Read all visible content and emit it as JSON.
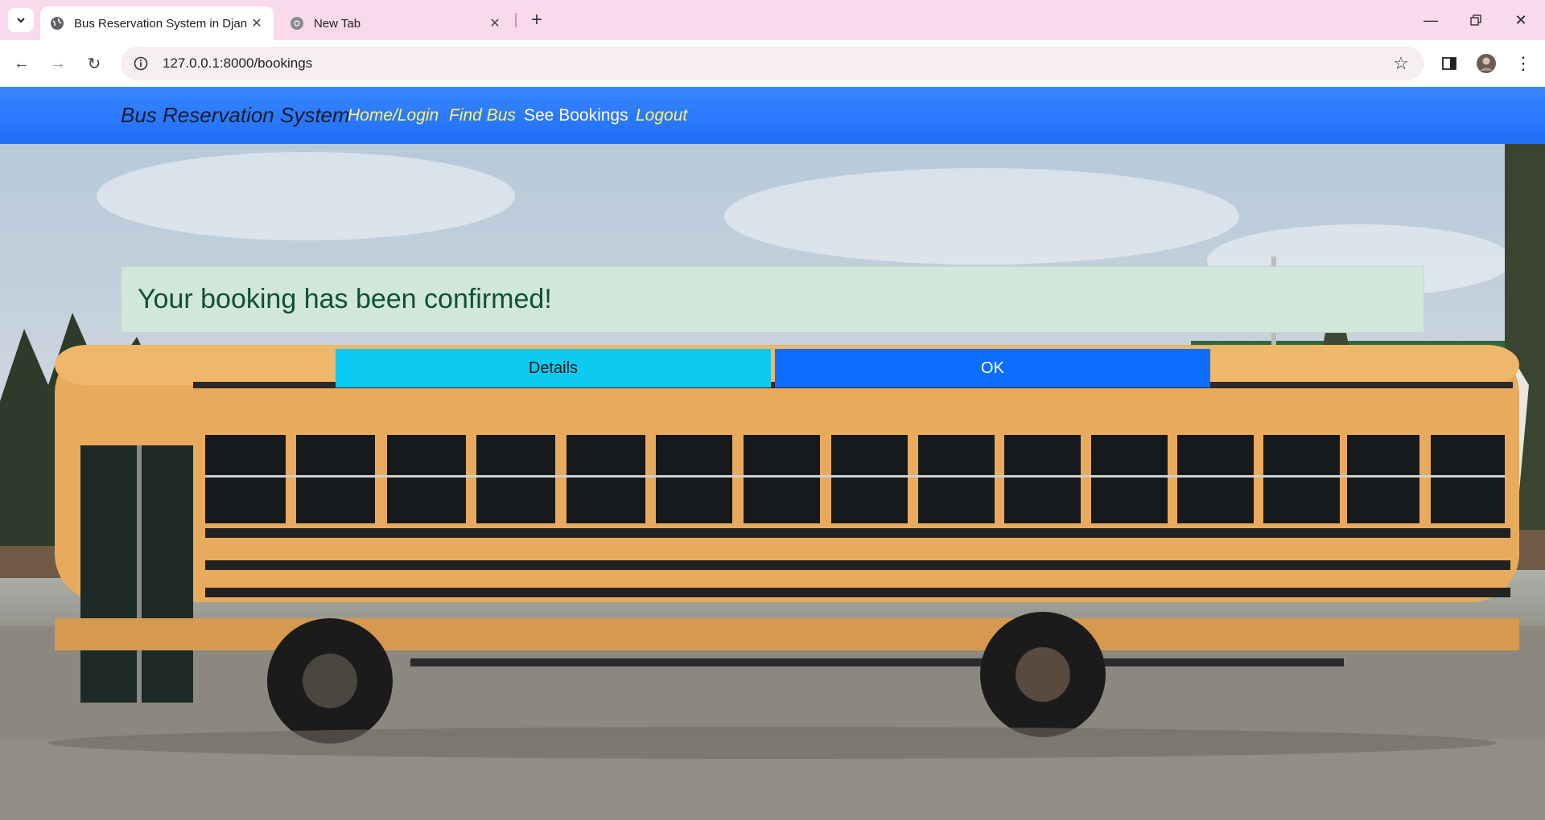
{
  "browser": {
    "tabs": [
      {
        "title": "Bus Reservation System in Djan",
        "active": true
      },
      {
        "title": "New Tab",
        "active": false
      }
    ],
    "address": "127.0.0.1:8000/bookings"
  },
  "navbar": {
    "brand": "Bus Reservation System",
    "links": [
      {
        "label": "Home/Login"
      },
      {
        "label": "Find Bus"
      },
      {
        "label": "See Bookings"
      },
      {
        "label": "Logout"
      }
    ]
  },
  "alert": {
    "message": "Your booking has been confirmed!"
  },
  "buttons": {
    "details": "Details",
    "ok": "OK"
  },
  "colors": {
    "navbar": "#2a7bfd",
    "link": "#fdf36a",
    "alert_bg": "#d1e7dc",
    "alert_text": "#0f5132",
    "details_btn": "#0dcaf0",
    "ok_btn": "#0d6efd",
    "bus": "#e6a95a"
  }
}
